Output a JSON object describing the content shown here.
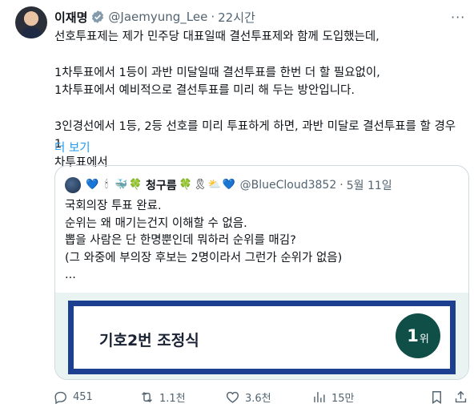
{
  "author": {
    "name": "이재명",
    "handle": "@Jaemyung_Lee",
    "separator": "·",
    "time": "22시간"
  },
  "more_menu": "···",
  "body": {
    "paragraphs": [
      [
        "선호투표제는 제가 민주당 대표일때 결선투표제와 함께 도입했는데,"
      ],
      [
        "1차투표에서 1등이 과반 미달일때 결선투표를 한번 더 할 필요없이,",
        "1차투표에서 예비적으로 결선투표를 미리 해 두는 방안입니다."
      ],
      [
        "3인경선에서 1등, 2등 선호를 미리 투표하게 하면, 과반 미달로 결선투표를 할 경우 1",
        "차투표에서"
      ]
    ],
    "show_more": "더 보기"
  },
  "quote": {
    "name_emojis_before": [
      "💙",
      "🕯",
      "🐳",
      "🍀"
    ],
    "name": "청구름",
    "name_emojis_after": [
      "🍀",
      "🎗",
      "⛅",
      "💙"
    ],
    "handle": "@BlueCloud3852",
    "separator": "·",
    "date": "5월 11일",
    "lines": [
      "국회의장 투표 완료.",
      "순위는 왜 매기는건지 이해할 수 없음.",
      "뽑을 사람은 단 한명뿐인데 뭐하러 순위를 매김?",
      "(그 와중에 부의장 후보는 2명이라서 그런가 순위가 없음)",
      "..."
    ],
    "image": {
      "candidate": "기호2번 조정식",
      "rank_number": "1",
      "rank_suffix": "위"
    }
  },
  "actions": {
    "replies": "451",
    "reposts": "1.1천",
    "likes": "3.6천",
    "views": "15만"
  },
  "colors": {
    "link": "#1d9bf0",
    "secondary": "#536471",
    "verified": "#829aab",
    "frame_border": "#1d3f8f",
    "rank_badge": "#104f48"
  }
}
